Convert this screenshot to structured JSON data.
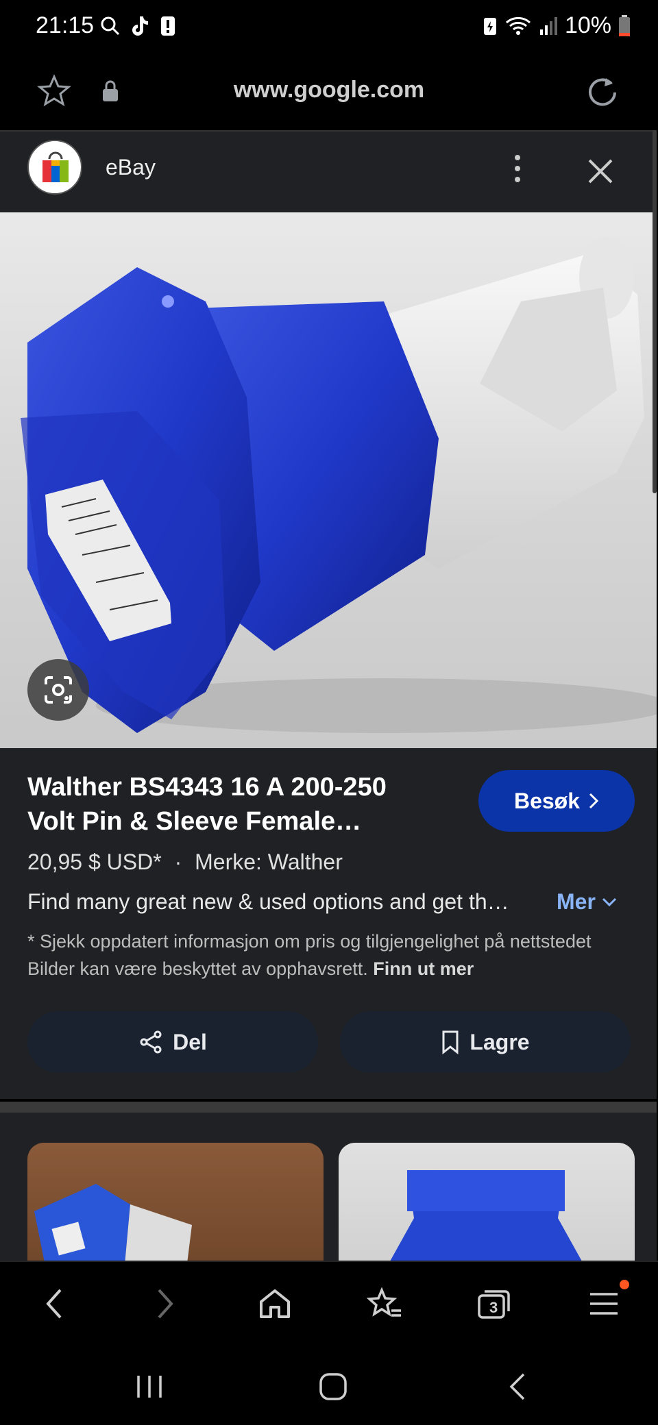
{
  "status": {
    "time": "21:15",
    "battery": "10%"
  },
  "urlbar": {
    "url": "www.google.com"
  },
  "site": {
    "name": "eBay"
  },
  "product": {
    "title": "Walther BS4343 16 A 200-250 Volt Pin & Sleeve Female…",
    "visit_label": "Besøk",
    "price": "20,95 $ USD*",
    "dot": "·",
    "brand": "Merke: Walther",
    "description": "Find many great new & used options and get th…",
    "more_label": "Mer",
    "note": "* Sjekk oppdatert informasjon om pris og tilgjengelighet på nettstedet Bilder kan være beskyttet av opphavsrett.",
    "note_link": "Finn ut mer"
  },
  "actions": {
    "share_label": "Del",
    "save_label": "Lagre"
  },
  "nav": {
    "tabs_count": "3"
  },
  "colors": {
    "accent": "#0a34a8",
    "link": "#8ab4f8",
    "notification_dot": "#ff5722"
  }
}
